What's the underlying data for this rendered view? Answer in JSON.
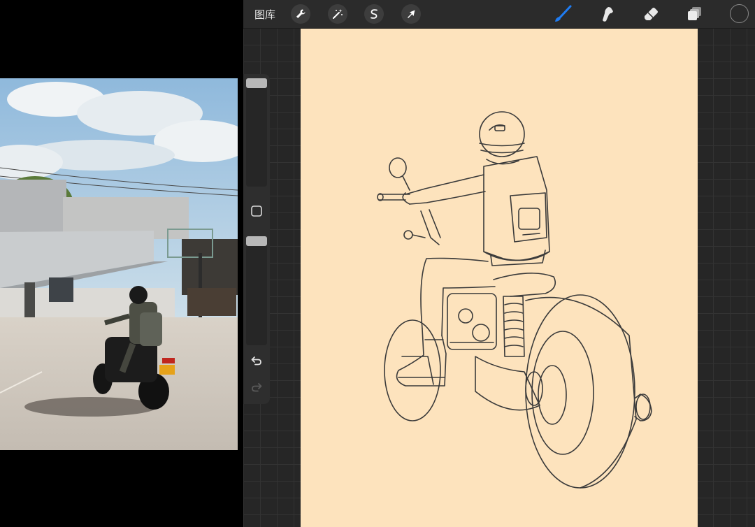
{
  "toolbar": {
    "gallery_label": "图库",
    "left_tools": [
      {
        "name": "actions",
        "icon": "wrench-icon"
      },
      {
        "name": "adjustments",
        "icon": "magic-wand-icon"
      },
      {
        "name": "selection",
        "icon": "selection-s-icon"
      },
      {
        "name": "transform",
        "icon": "arrow-cursor-icon"
      }
    ],
    "right_tools": [
      {
        "name": "brush",
        "icon": "brush-icon",
        "active": true
      },
      {
        "name": "smudge",
        "icon": "smudge-icon",
        "active": false
      },
      {
        "name": "eraser",
        "icon": "eraser-icon",
        "active": false
      },
      {
        "name": "layers",
        "icon": "layers-icon",
        "active": false
      }
    ],
    "current_color": "#2a2a2a"
  },
  "sidebar": {
    "brush_size_level": 0.0,
    "opacity_level": 0.0,
    "buttons": [
      "modify-square-icon",
      "undo-icon",
      "redo-icon"
    ]
  },
  "colors": {
    "active_tool": "#1f7cf2",
    "canvas_paper": "#fde3bd",
    "line_art": "#3a3a3a",
    "app_background": "#2a2a2a"
  }
}
